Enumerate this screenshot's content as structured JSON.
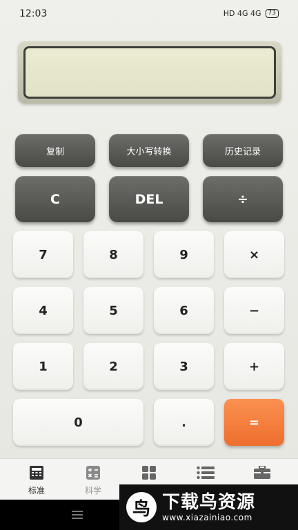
{
  "status": {
    "time": "12:03",
    "indicators": "HD  4G  4G",
    "battery": "73"
  },
  "display": {
    "value": ""
  },
  "top_buttons": [
    "复制",
    "大小写转换",
    "历史记录"
  ],
  "func_buttons": [
    "C",
    "DEL",
    "÷"
  ],
  "keys": {
    "row1": [
      "7",
      "8",
      "9",
      "×"
    ],
    "row2": [
      "4",
      "5",
      "6",
      "−"
    ],
    "row3": [
      "1",
      "2",
      "3",
      "+"
    ],
    "row4": [
      "0",
      ".",
      "="
    ]
  },
  "tabs": [
    {
      "label": "标准",
      "icon": "calculator-icon"
    },
    {
      "label": "科学",
      "icon": "scientific-icon"
    },
    {
      "label": "",
      "icon": "grid-icon"
    },
    {
      "label": "",
      "icon": "list-icon"
    },
    {
      "label": "",
      "icon": "toolbox-icon"
    }
  ],
  "watermark": {
    "logo": "鸟",
    "title": "下载鸟资源",
    "url": "www.xiazainiao.com"
  },
  "colors": {
    "accent": "#f47c3c",
    "dark_key": "#5a5a57",
    "light_key": "#f7f7f5"
  }
}
